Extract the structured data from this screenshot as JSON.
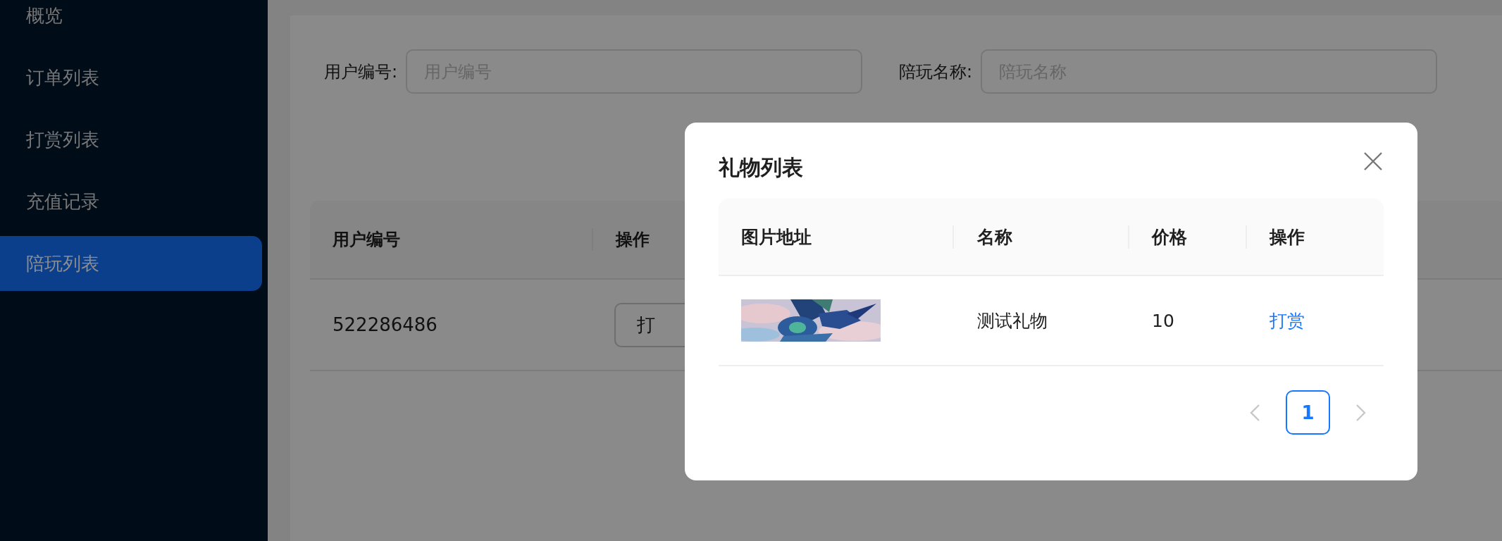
{
  "sidebar": {
    "items": [
      {
        "label": "概览",
        "selected": false
      },
      {
        "label": "订单列表",
        "selected": false
      },
      {
        "label": "打赏列表",
        "selected": false
      },
      {
        "label": "充值记录",
        "selected": false
      },
      {
        "label": "陪玩列表",
        "selected": true
      }
    ]
  },
  "search": {
    "fields": [
      {
        "label": "用户编号:",
        "placeholder": "用户编号"
      },
      {
        "label": "陪玩名称:",
        "placeholder": "陪玩名称"
      }
    ]
  },
  "table": {
    "columns": [
      "用户编号",
      "操作"
    ],
    "rows": [
      {
        "user_id": "522286486",
        "action": "打"
      }
    ]
  },
  "modal": {
    "title": "礼物列表",
    "table": {
      "columns": [
        "图片地址",
        "名称",
        "价格",
        "操作"
      ],
      "rows": [
        {
          "name": "测试礼物",
          "price": "10",
          "action": "打赏"
        }
      ]
    },
    "pagination": {
      "prev": {
        "disabled": true
      },
      "pages": [
        {
          "label": "1",
          "selected": true
        }
      ],
      "next": {
        "disabled": true
      }
    }
  }
}
